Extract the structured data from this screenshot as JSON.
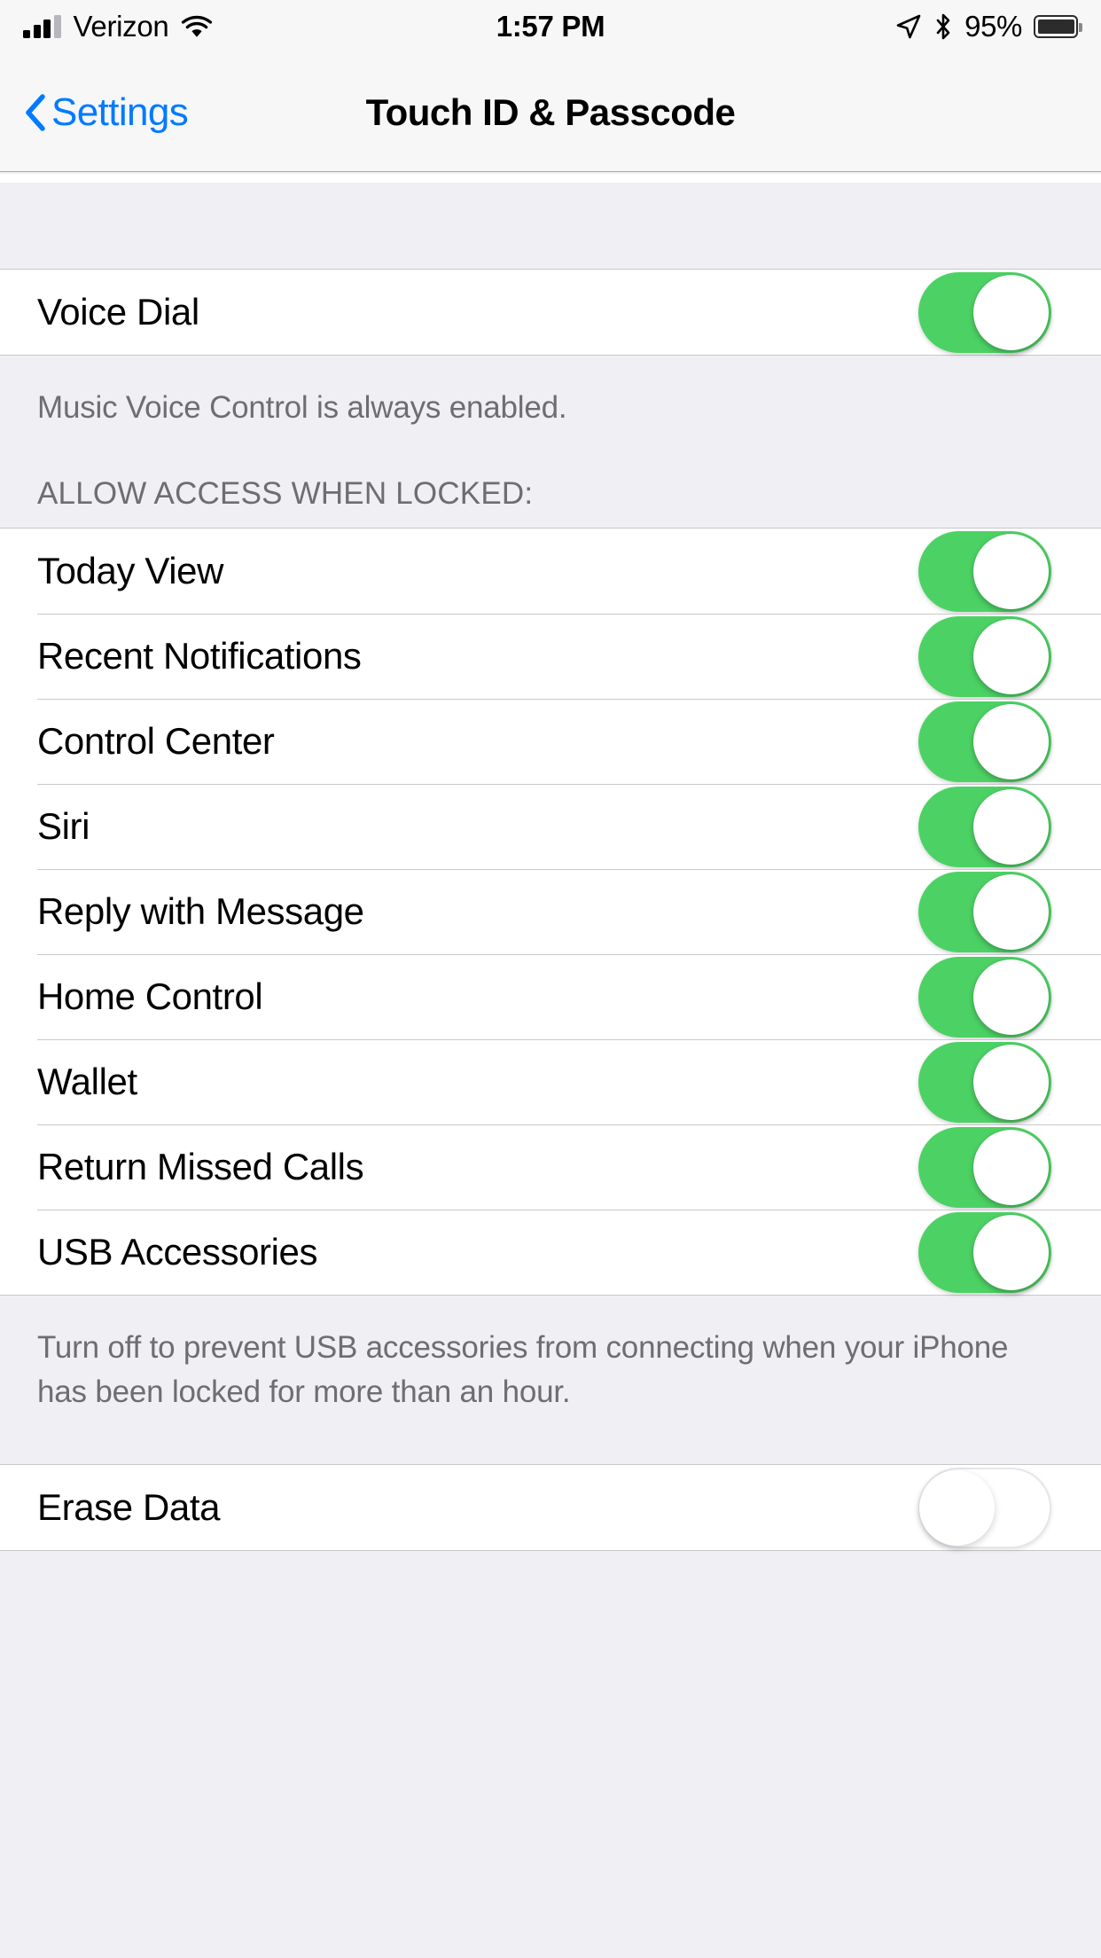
{
  "status_bar": {
    "carrier": "Verizon",
    "time": "1:57 PM",
    "battery_percent": "95%",
    "signal_bars_filled": 3,
    "signal_bars_total": 4,
    "icons": [
      "signal-bars-icon",
      "wifi-icon",
      "location-arrow-icon",
      "bluetooth-icon",
      "battery-icon"
    ]
  },
  "nav": {
    "back_label": "Settings",
    "title": "Touch ID & Passcode"
  },
  "voice_section": {
    "rows": [
      {
        "label": "Voice Dial",
        "enabled": true
      }
    ],
    "footer": "Music Voice Control is always enabled."
  },
  "allow_access_section": {
    "header": "ALLOW ACCESS WHEN LOCKED:",
    "rows": [
      {
        "label": "Today View",
        "enabled": true
      },
      {
        "label": "Recent Notifications",
        "enabled": true
      },
      {
        "label": "Control Center",
        "enabled": true
      },
      {
        "label": "Siri",
        "enabled": true
      },
      {
        "label": "Reply with Message",
        "enabled": true
      },
      {
        "label": "Home Control",
        "enabled": true
      },
      {
        "label": "Wallet",
        "enabled": true
      },
      {
        "label": "Return Missed Calls",
        "enabled": true
      },
      {
        "label": "USB Accessories",
        "enabled": true
      }
    ],
    "footer": "Turn off to prevent USB accessories from connecting when your iPhone has been locked for more than an hour."
  },
  "erase_section": {
    "rows": [
      {
        "label": "Erase Data",
        "enabled": false
      }
    ]
  },
  "colors": {
    "accent_blue": "#007AFF",
    "toggle_on_green": "#4CD264",
    "background_gray": "#EFEFF4",
    "separator": "#C8C7CC",
    "secondary_text": "#6D6D72"
  }
}
